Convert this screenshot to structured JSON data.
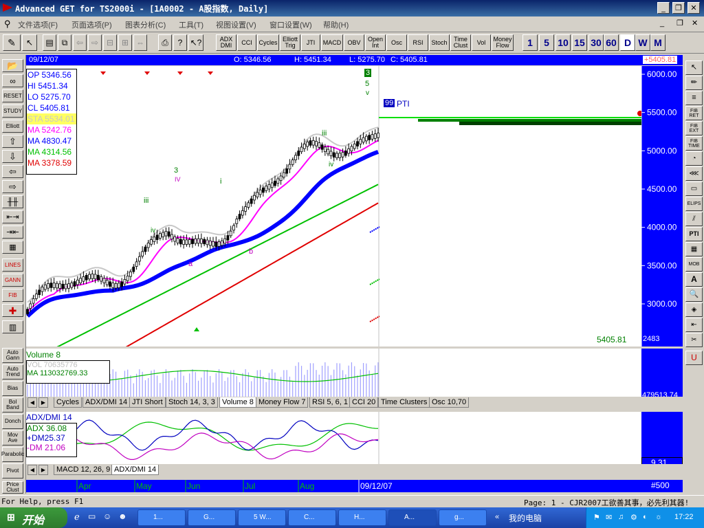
{
  "window": {
    "title": "Advanced GET for TS2000i - [1A0002 - A股指数, Daily]"
  },
  "menu": [
    "文件选项(F)",
    "页面选项(P)",
    "图表分析(C)",
    "工具(T)",
    "视图设置(V)",
    "窗口设置(W)",
    "帮助(H)"
  ],
  "toolbar": {
    "indicators": [
      "ADX DMI",
      "CCI",
      "Cycles",
      "Elliott Trig",
      "JTI",
      "MACD",
      "OBV",
      "Open Int",
      "Osc",
      "RSI",
      "Stoch",
      "Time Clust",
      "Vol",
      "Money Flow"
    ],
    "periods": [
      "1",
      "5",
      "10",
      "15",
      "30",
      "60",
      "D",
      "W",
      "M"
    ],
    "active_period": "D"
  },
  "left_tools": [
    "RESET",
    "STUDY",
    "Elliott",
    "LINES",
    "GANN",
    "FIB"
  ],
  "left_labels": [
    "Auto Gann",
    "Auto Trend",
    "Bias",
    "Bol Band",
    "Donch",
    "Mov Ave",
    "Parabolic",
    "Pivot",
    "Price Clust",
    "Seasonal"
  ],
  "right_tools": [
    "FIB RET",
    "FIB EXT",
    "FIB TIME",
    "ELIPS",
    "PTI",
    "MOB",
    "A"
  ],
  "infobar": {
    "date": "09/12/07",
    "open": "O: 5346.56",
    "high": "H: 5451.34",
    "low": "L: 5275.70",
    "close": "C: 5405.81",
    "last": "+5405.81"
  },
  "legend": [
    {
      "label": "OP 5346.56",
      "color": "#0000ff"
    },
    {
      "label": "HI  5451.34",
      "color": "#0000ff"
    },
    {
      "label": "LO  5275.70",
      "color": "#0000ff"
    },
    {
      "label": "CL  5405.81",
      "color": "#0000ff"
    },
    {
      "label": "STA 5534.01",
      "color": "#c8c8c8"
    },
    {
      "label": "MA 5242.76",
      "color": "#ff00ff"
    },
    {
      "label": "MA 4830.47",
      "color": "#0000ff"
    },
    {
      "label": "MA 4314.56",
      "color": "#00c000"
    },
    {
      "label": "MA 3378.59",
      "color": "#e00000"
    }
  ],
  "wave_labels": {
    "w3_top": "3",
    "w5": "5",
    "w5_small": "v",
    "iii_1": "iii",
    "iv_1": "iv",
    "iii_2": "iii",
    "iv_2": "iv",
    "i": "i",
    "a": "a",
    "b": "b",
    "iv_badge": "IV"
  },
  "pti": {
    "value": "99",
    "label": "PTI"
  },
  "chart_data": {
    "type": "candlestick",
    "price_axis_ticks": [
      "6000.00",
      "5500.00",
      "5000.00",
      "4500.00",
      "4000.00",
      "3500.00",
      "3000.00"
    ],
    "price_axis_bottom": "2483",
    "price_axis_current": "5405.81",
    "close_label": "5405.81",
    "ylim": [
      2483,
      6000
    ],
    "x_months": [
      "Apr",
      "May",
      "Jun",
      "Jul",
      "Aug"
    ],
    "current_date": "09/12/07"
  },
  "volume": {
    "title": "Volume 8",
    "vol": "VOL 70635776",
    "ma": "MA  113032769.33",
    "axis": "479513.74"
  },
  "tabs1": [
    "Cycles",
    "ADX/DMI 14",
    "JTI Short",
    "Stoch 14, 3, 3",
    "Volume 8",
    "Money Flow 7",
    "RSI 5, 6, 1",
    "CCI 20",
    "Time Clusters",
    "Osc 10,70"
  ],
  "adx": {
    "title": "ADX/DMI 14",
    "adx": "ADX 36.08",
    "pdm": "+DM25.37",
    "mdm": "-DM 21.06",
    "axis": "9.31"
  },
  "tabs2": [
    "MACD 12, 26, 9",
    "ADX/DMI 14"
  ],
  "bars_label": "#500",
  "status": {
    "left": "For Help, press F1",
    "right": "Page: 1 - CJR2007工欲善其事，必先利其器!"
  },
  "taskbar": {
    "start": "开始",
    "tasks": [
      "1...",
      "G...",
      "5 W...",
      "C...",
      "H...",
      "A...",
      "g..."
    ],
    "tray_text": "我的电脑",
    "clock": "17:22"
  }
}
